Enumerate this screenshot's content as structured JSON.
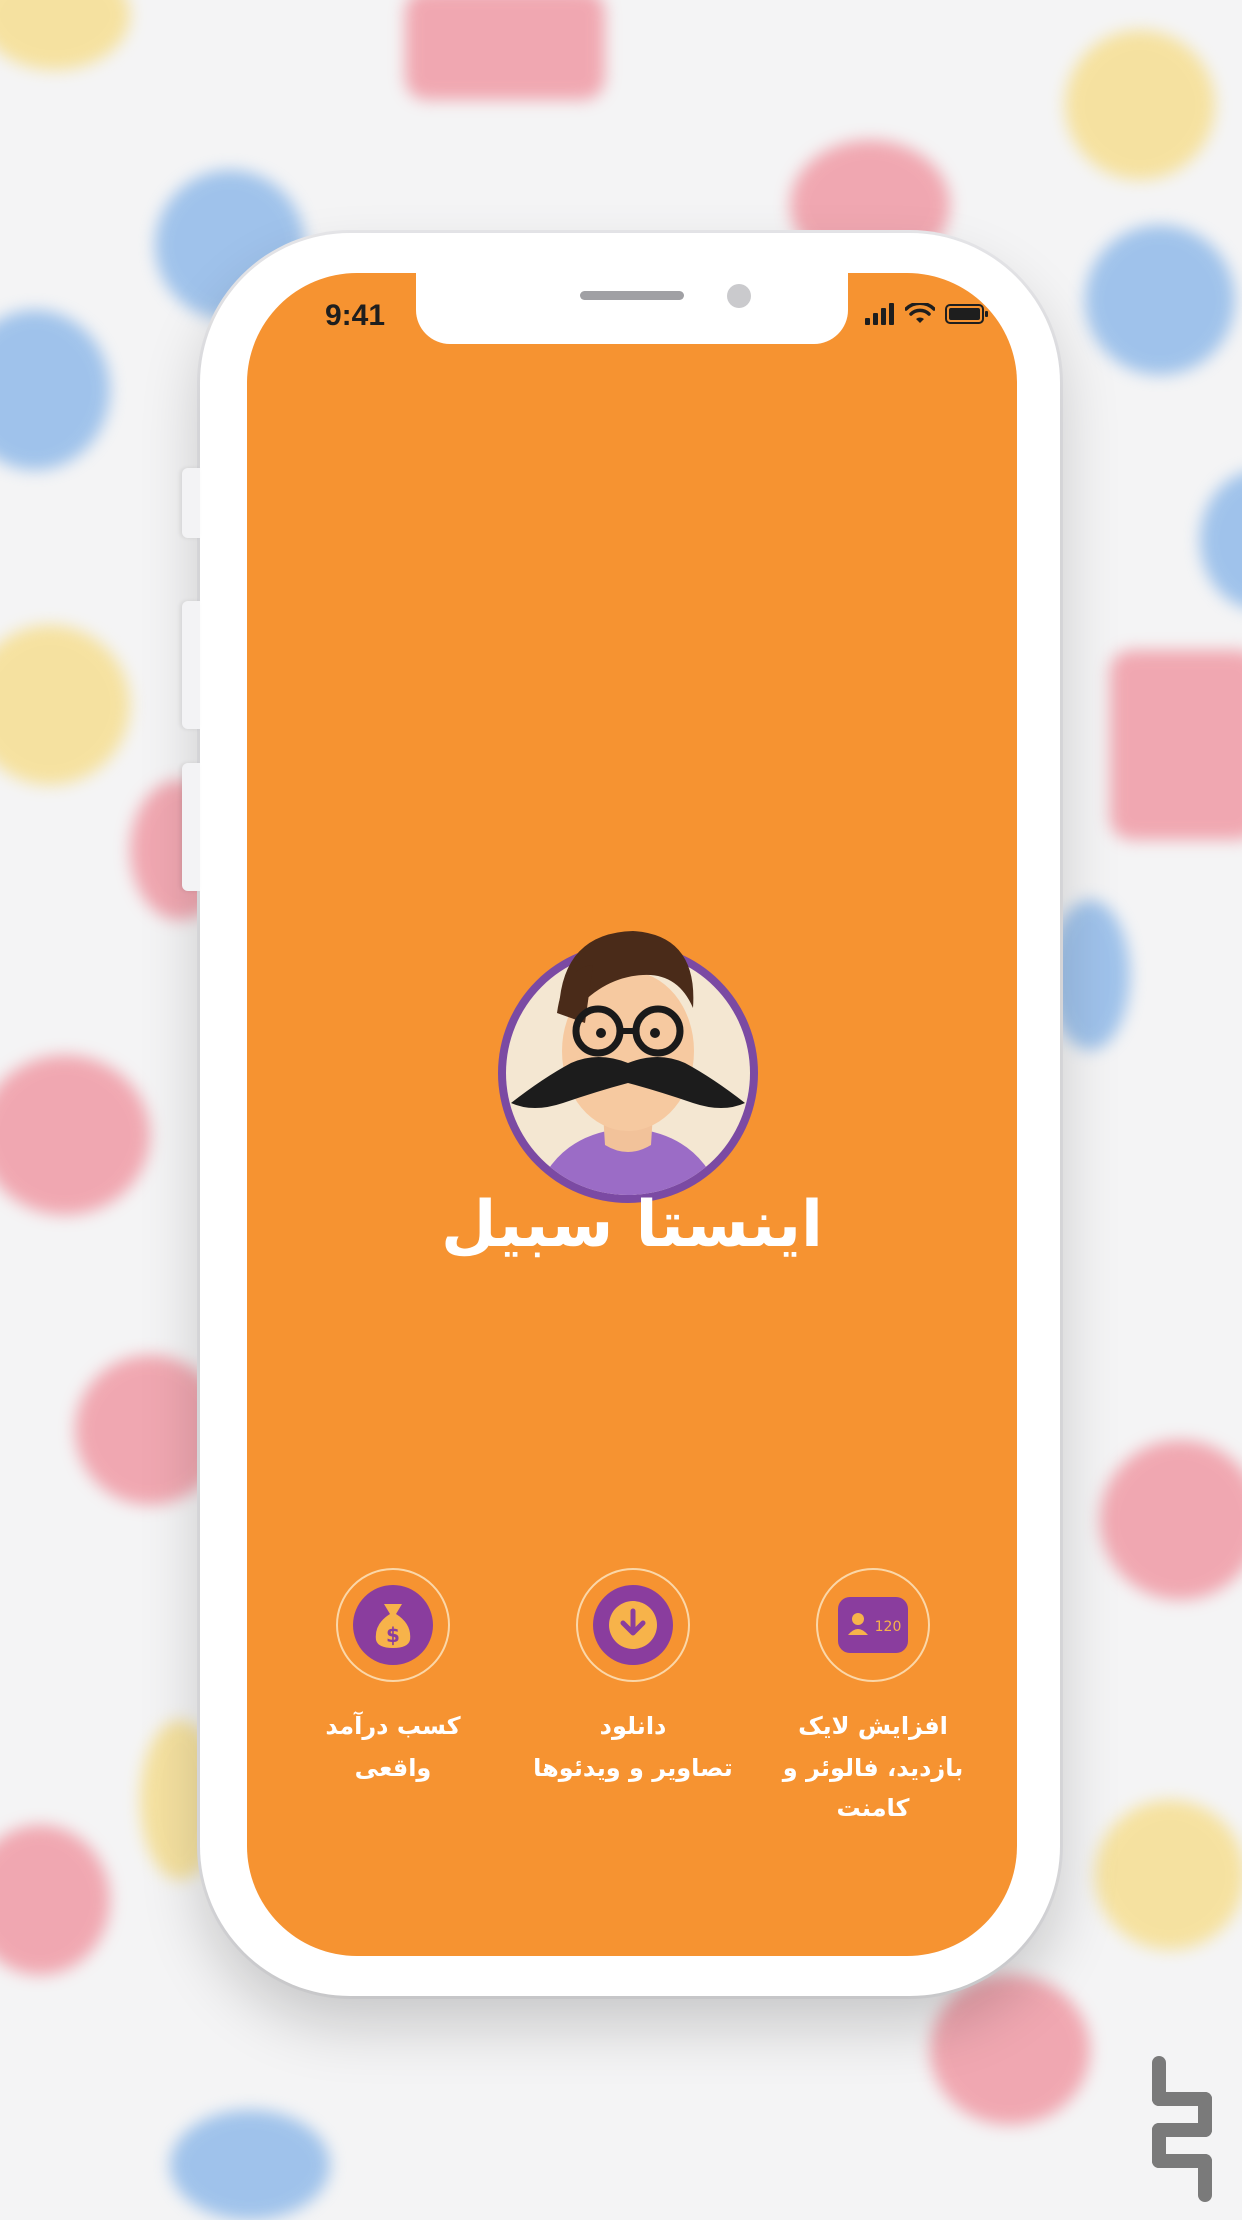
{
  "status_bar": {
    "time": "9:41"
  },
  "app": {
    "name": "اینستا سبیل"
  },
  "features": [
    {
      "icon": "profile-card-icon",
      "badge": "120",
      "line1": "افزایش لایک",
      "line2": "بازدید، فالوئر و کامنت"
    },
    {
      "icon": "download-icon",
      "line1": "دانلود",
      "line2": "تصاویر و ویدئوها"
    },
    {
      "icon": "money-bag-icon",
      "line1": "کسب درآمد",
      "line2": "واقعی"
    }
  ],
  "colors": {
    "screen": "#f69331",
    "accent_purple": "#8a3d9e",
    "background": "#f4f4f5"
  }
}
